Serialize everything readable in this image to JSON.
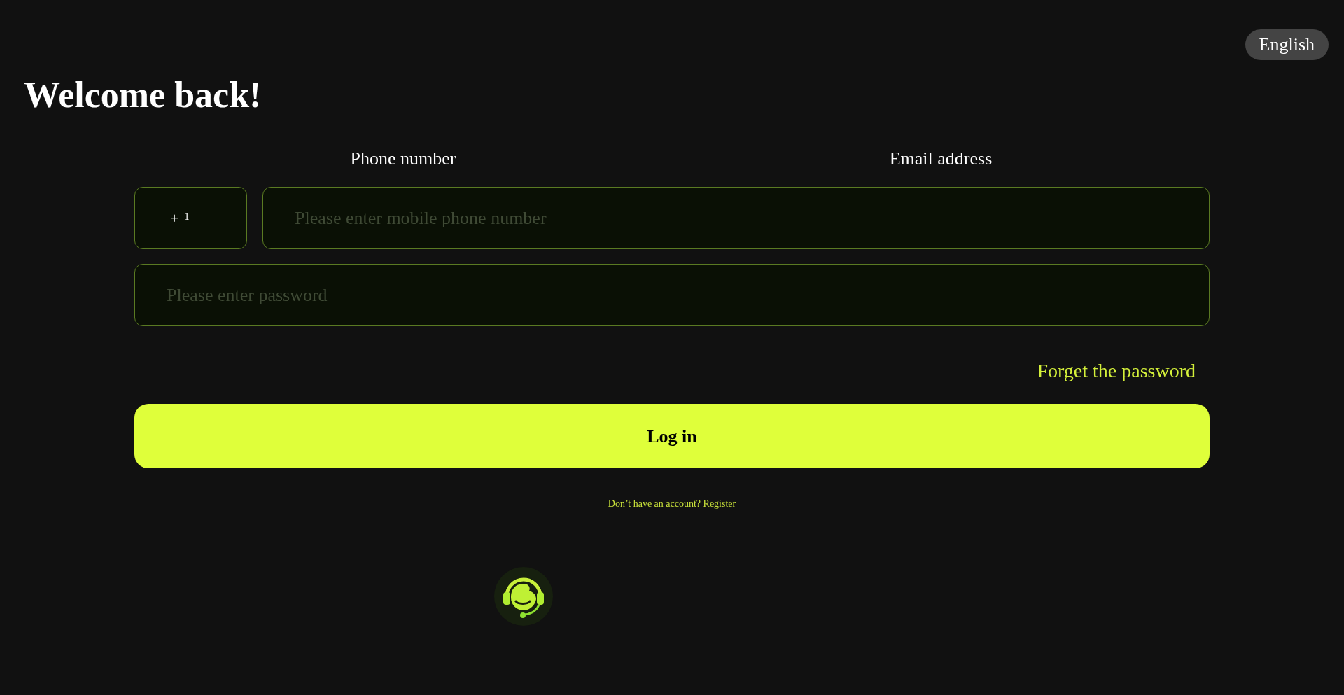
{
  "language_button": "English",
  "title": "Welcome back!",
  "tabs": [
    {
      "label": "Phone number"
    },
    {
      "label": "Email address"
    }
  ],
  "country_code": {
    "plus": "+",
    "code": "1"
  },
  "phone_field": {
    "placeholder": "Please enter mobile phone number"
  },
  "password_field": {
    "placeholder": "Please enter password"
  },
  "forgot_link": "Forget the password",
  "login_button": "Log in",
  "register_link": "Don’t have an account? Register"
}
